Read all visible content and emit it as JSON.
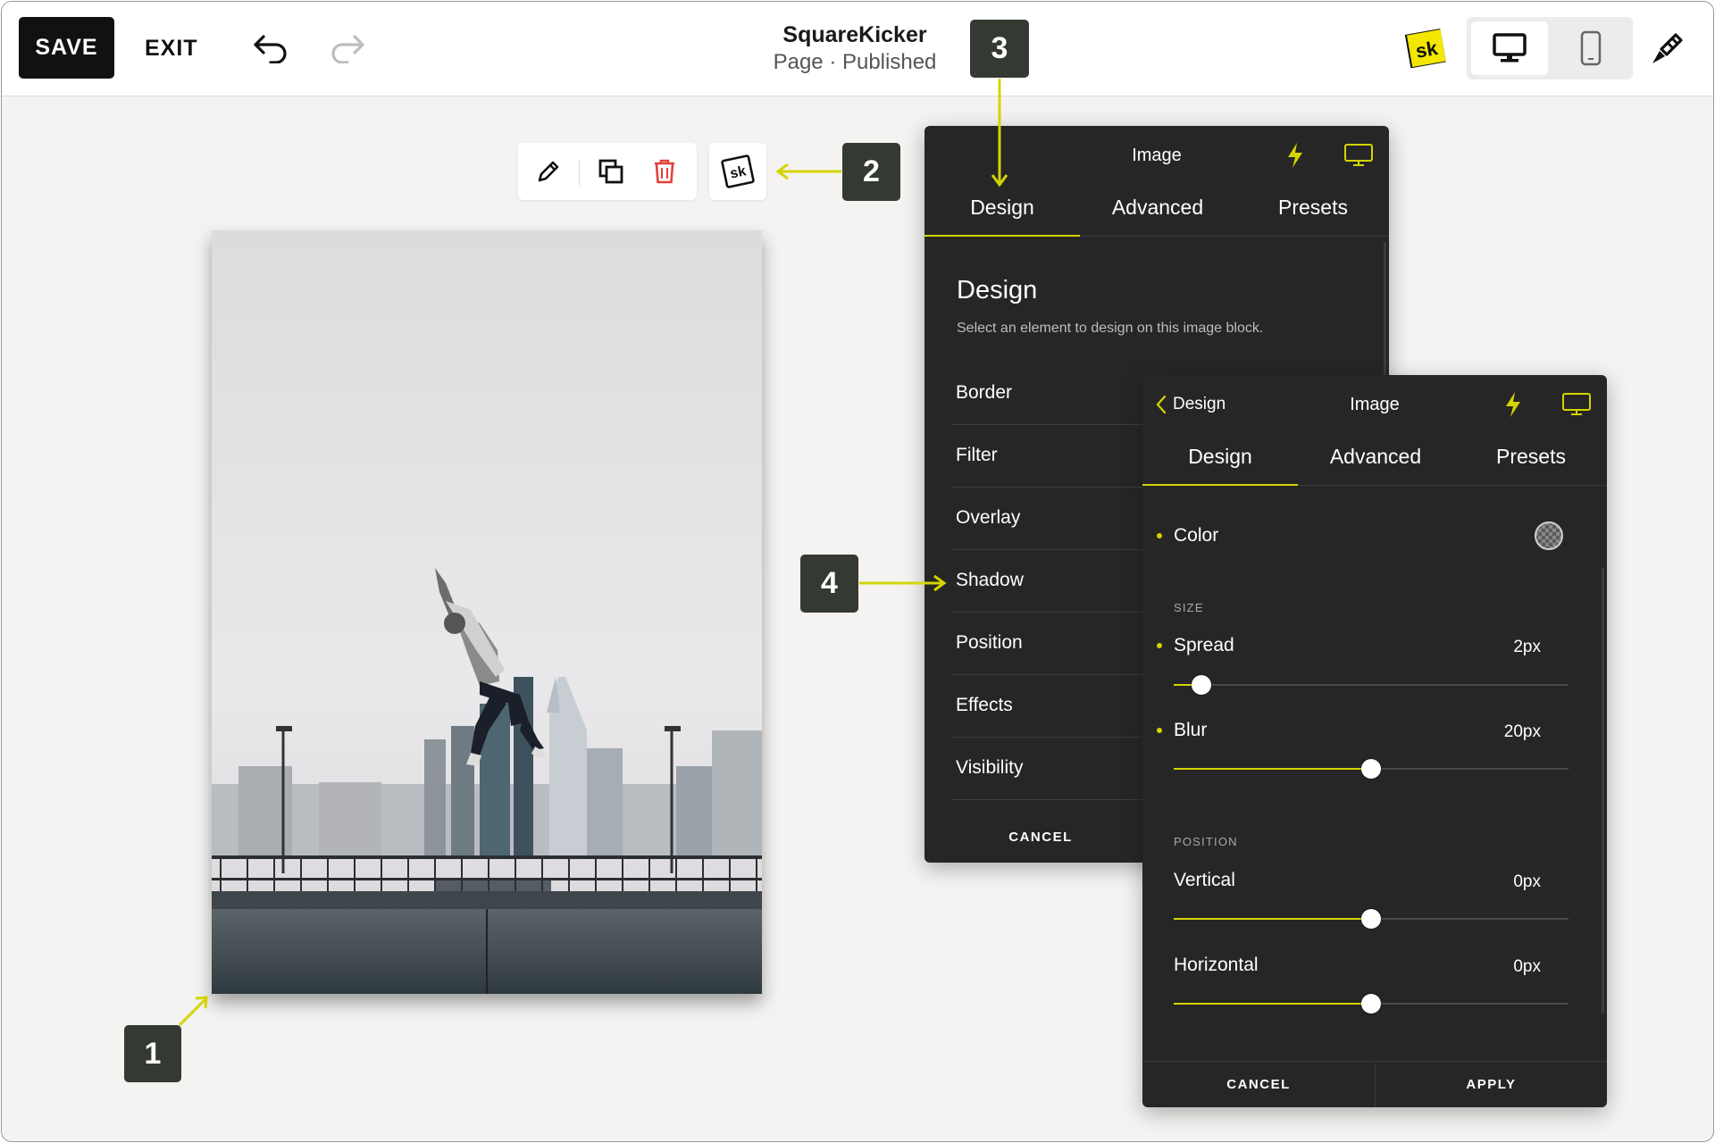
{
  "topbar": {
    "save_label": "SAVE",
    "exit_label": "EXIT",
    "title": "SquareKicker",
    "subtitle": "Page · Published",
    "sk_logo_text": "sk"
  },
  "block_toolbar": {
    "sk_label": "sk"
  },
  "callouts": {
    "one": "1",
    "two": "2",
    "three": "3",
    "four": "4"
  },
  "panel_main": {
    "header_title": "Image",
    "tabs": [
      "Design",
      "Advanced",
      "Presets"
    ],
    "heading": "Design",
    "description": "Select an element to design on this image block.",
    "menu": [
      "Border",
      "Filter",
      "Overlay",
      "Shadow",
      "Position",
      "Effects",
      "Visibility"
    ],
    "cancel_label": "CANCEL"
  },
  "panel_shadow": {
    "back_label": "Design",
    "header_title": "Image",
    "tabs": [
      "Design",
      "Advanced",
      "Presets"
    ],
    "color_label": "Color",
    "size_section": "SIZE",
    "spread_label": "Spread",
    "spread_value": "2px",
    "spread_fraction": 0.07,
    "blur_label": "Blur",
    "blur_value": "20px",
    "blur_fraction": 0.5,
    "position_section": "POSITION",
    "vertical_label": "Vertical",
    "vertical_value": "0px",
    "vertical_fraction": 0.5,
    "horizontal_label": "Horizontal",
    "horizontal_value": "0px",
    "horizontal_fraction": 0.5,
    "cancel_label": "CANCEL",
    "apply_label": "APPLY"
  },
  "colors": {
    "accent": "#d4d400",
    "panel_bg": "#262626",
    "callout_bg": "#343932",
    "delete_red": "#e0423a"
  }
}
